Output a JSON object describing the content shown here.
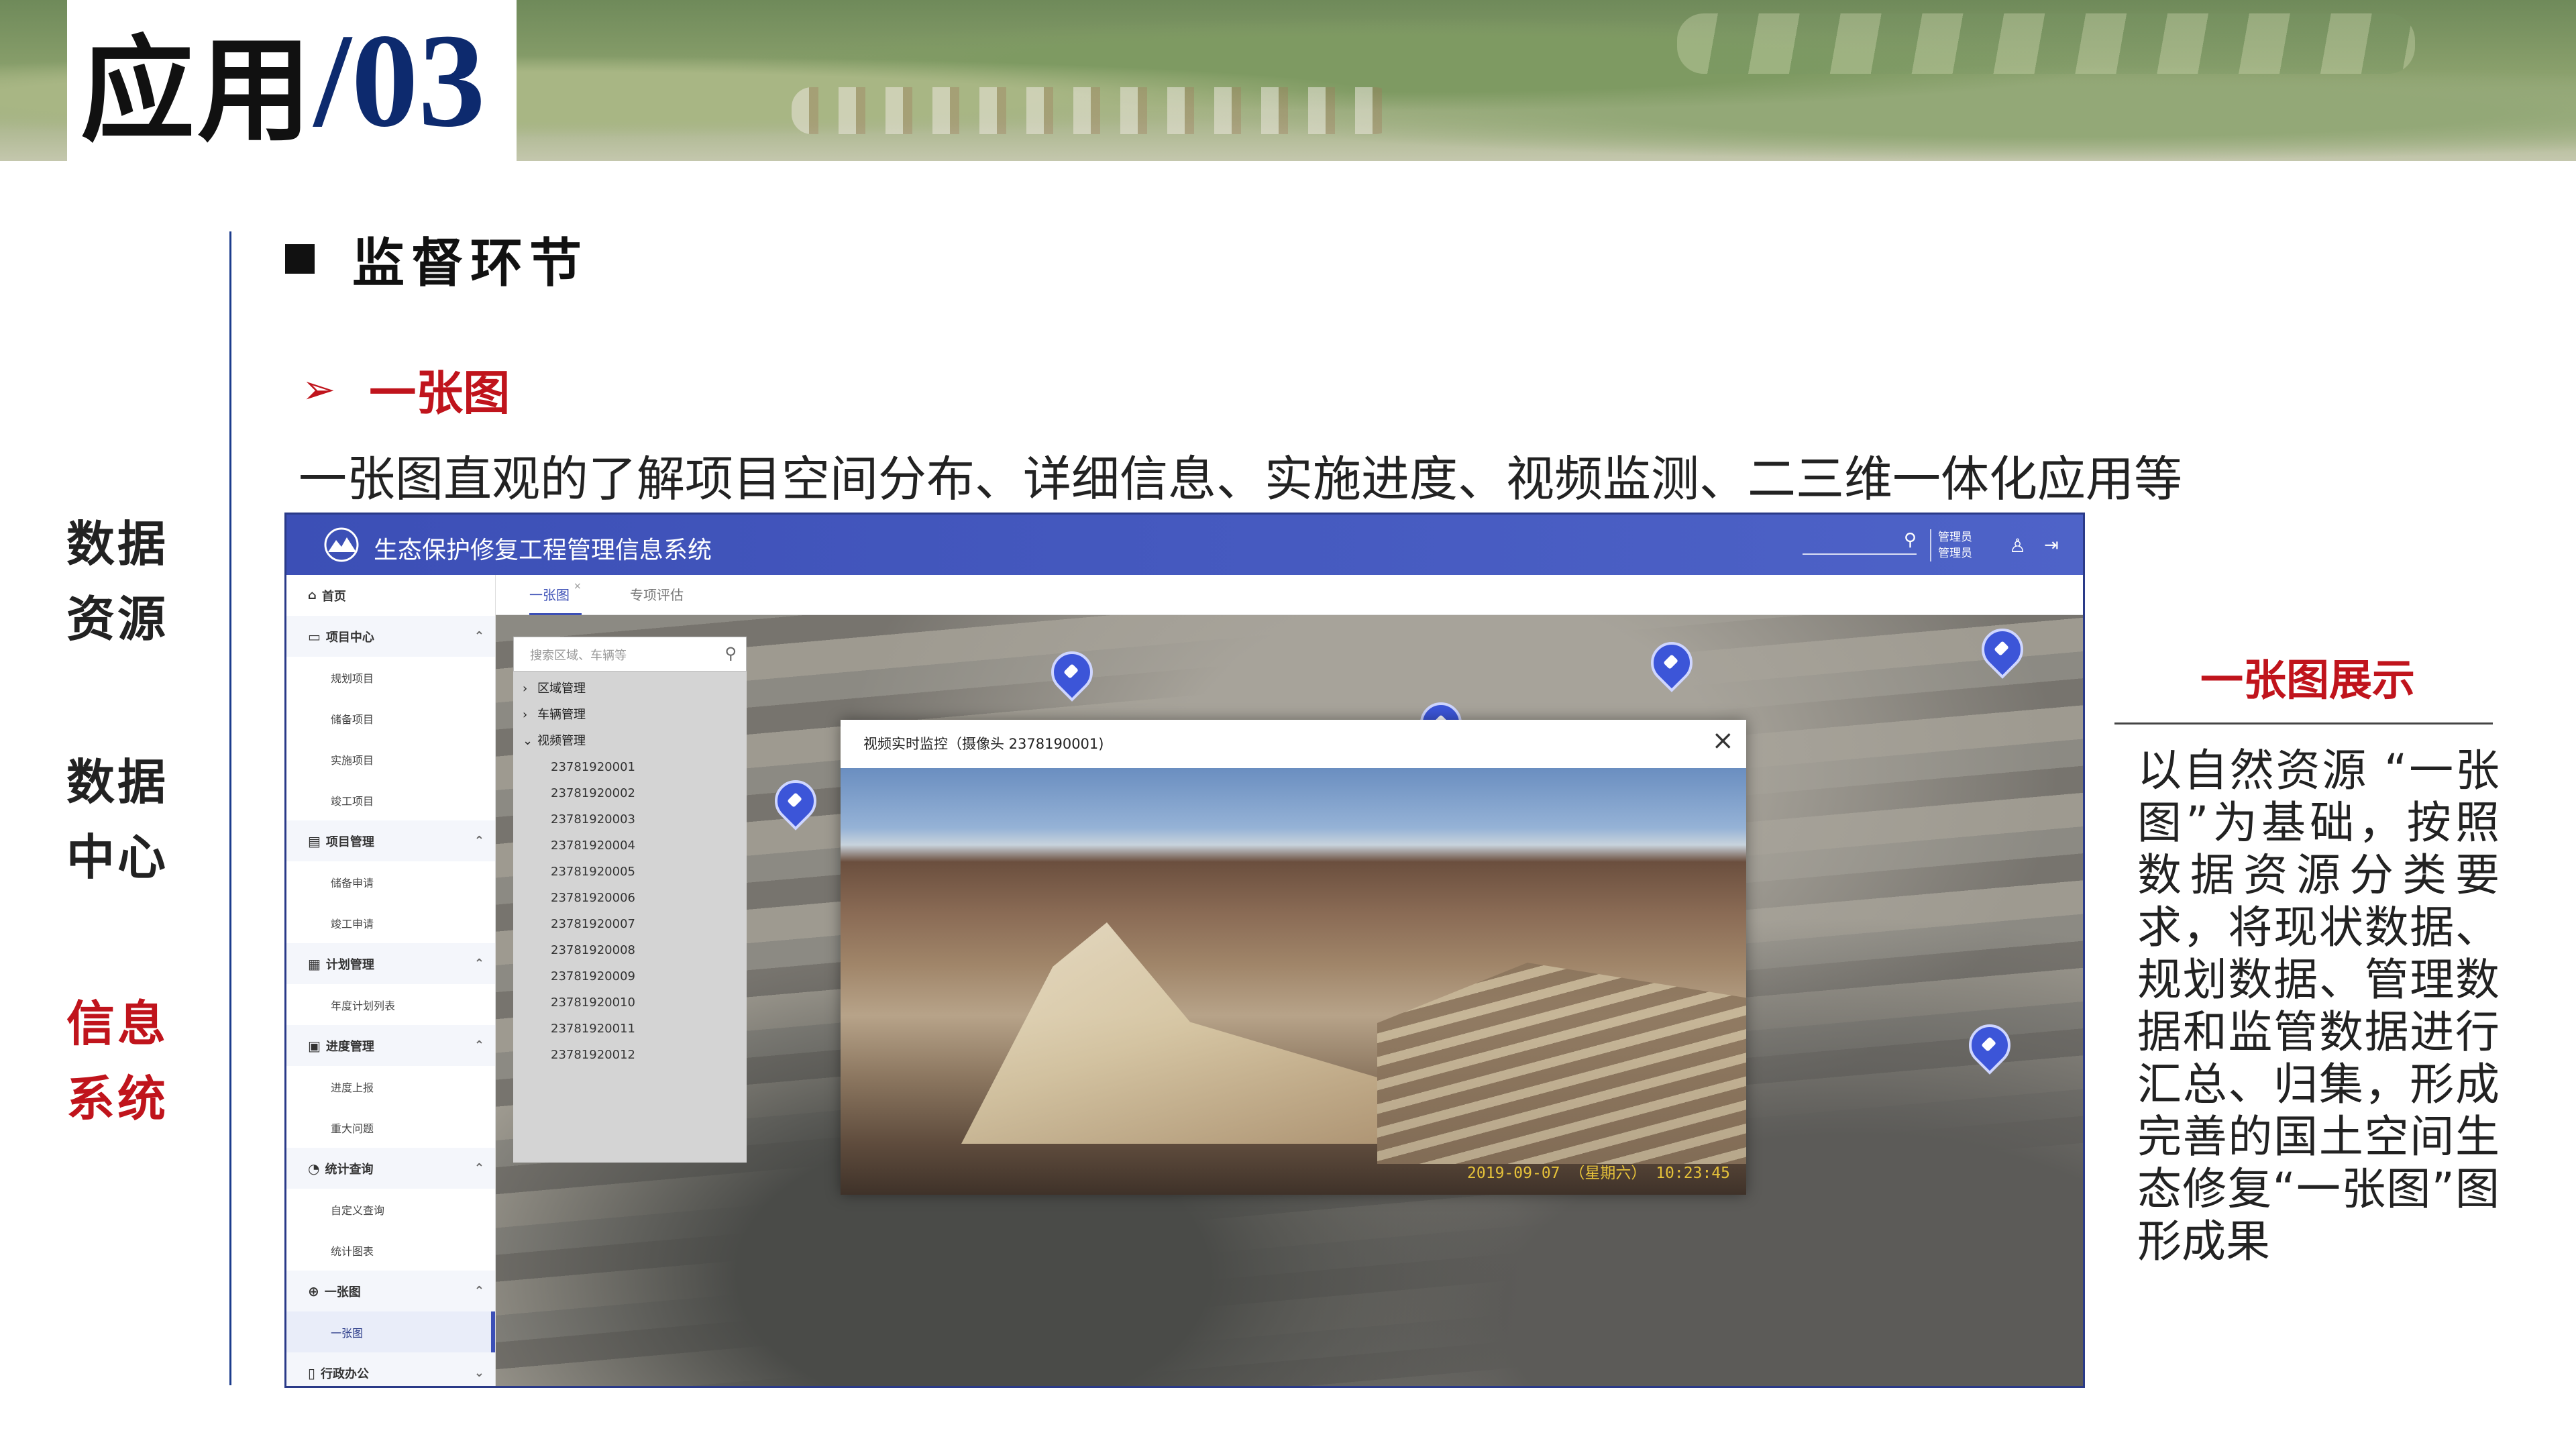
{
  "banner": {
    "title_cn": "应用",
    "title_num": "/03"
  },
  "left_nav": {
    "items": [
      {
        "line1": "数据",
        "line2": "资源",
        "active": false
      },
      {
        "line1": "数据",
        "line2": "中心",
        "active": false
      },
      {
        "line1": "信息",
        "line2": "系统",
        "active": true
      }
    ]
  },
  "section": {
    "heading": "监督环节",
    "subheading": "一张图",
    "description": "一张图直观的了解项目空间分布、详细信息、实施进度、视频监测、二三维一体化应用等"
  },
  "app": {
    "name": "生态保护修复工程管理信息系统",
    "header": {
      "user_line1": "管理员",
      "user_line2": "管理员",
      "search_icon": "search-icon",
      "user_icon": "user-icon",
      "logout_icon": "logout-icon"
    },
    "tabs": [
      {
        "label": "一张图",
        "active": true
      },
      {
        "label": "专项评估",
        "active": false
      }
    ],
    "sidebar": {
      "home": "首页",
      "groups": [
        {
          "label": "项目中心",
          "items": [
            "规划项目",
            "储备项目",
            "实施项目",
            "竣工项目"
          ]
        },
        {
          "label": "项目管理",
          "items": [
            "储备申请",
            "竣工申请"
          ]
        },
        {
          "label": "计划管理",
          "items": [
            "年度计划列表"
          ]
        },
        {
          "label": "进度管理",
          "items": [
            "进度上报",
            "重大问题"
          ]
        },
        {
          "label": "统计查询",
          "items": [
            "自定义查询",
            "统计图表"
          ]
        },
        {
          "label": "一张图",
          "items": [
            "一张图"
          ]
        },
        {
          "label": "行政办公",
          "items": []
        }
      ]
    },
    "tree": {
      "search_placeholder": "搜索区域、车辆等",
      "nodes": [
        {
          "label": "区域管理",
          "expanded": false
        },
        {
          "label": "车辆管理",
          "expanded": false
        },
        {
          "label": "视频管理",
          "expanded": true
        }
      ],
      "cameras": [
        "23781920001",
        "23781920002",
        "23781920003",
        "23781920004",
        "23781920005",
        "23781920006",
        "23781920007",
        "23781920008",
        "23781920009",
        "23781920010",
        "23781920011",
        "23781920012"
      ]
    },
    "video_modal": {
      "title": "视频实时监控（摄像头 2378190001)",
      "timestamp": "2019-09-07 （星期六） 10:23:45"
    }
  },
  "right_panel": {
    "title": "一张图展示",
    "text": "以自然资源 “一张图”为基础，按照数据资源分类要求，将现状数据、规划数据、管理数据和监管数据进行汇总、归集，形成完善的国土空间生态修复“一张图”图形成果"
  }
}
